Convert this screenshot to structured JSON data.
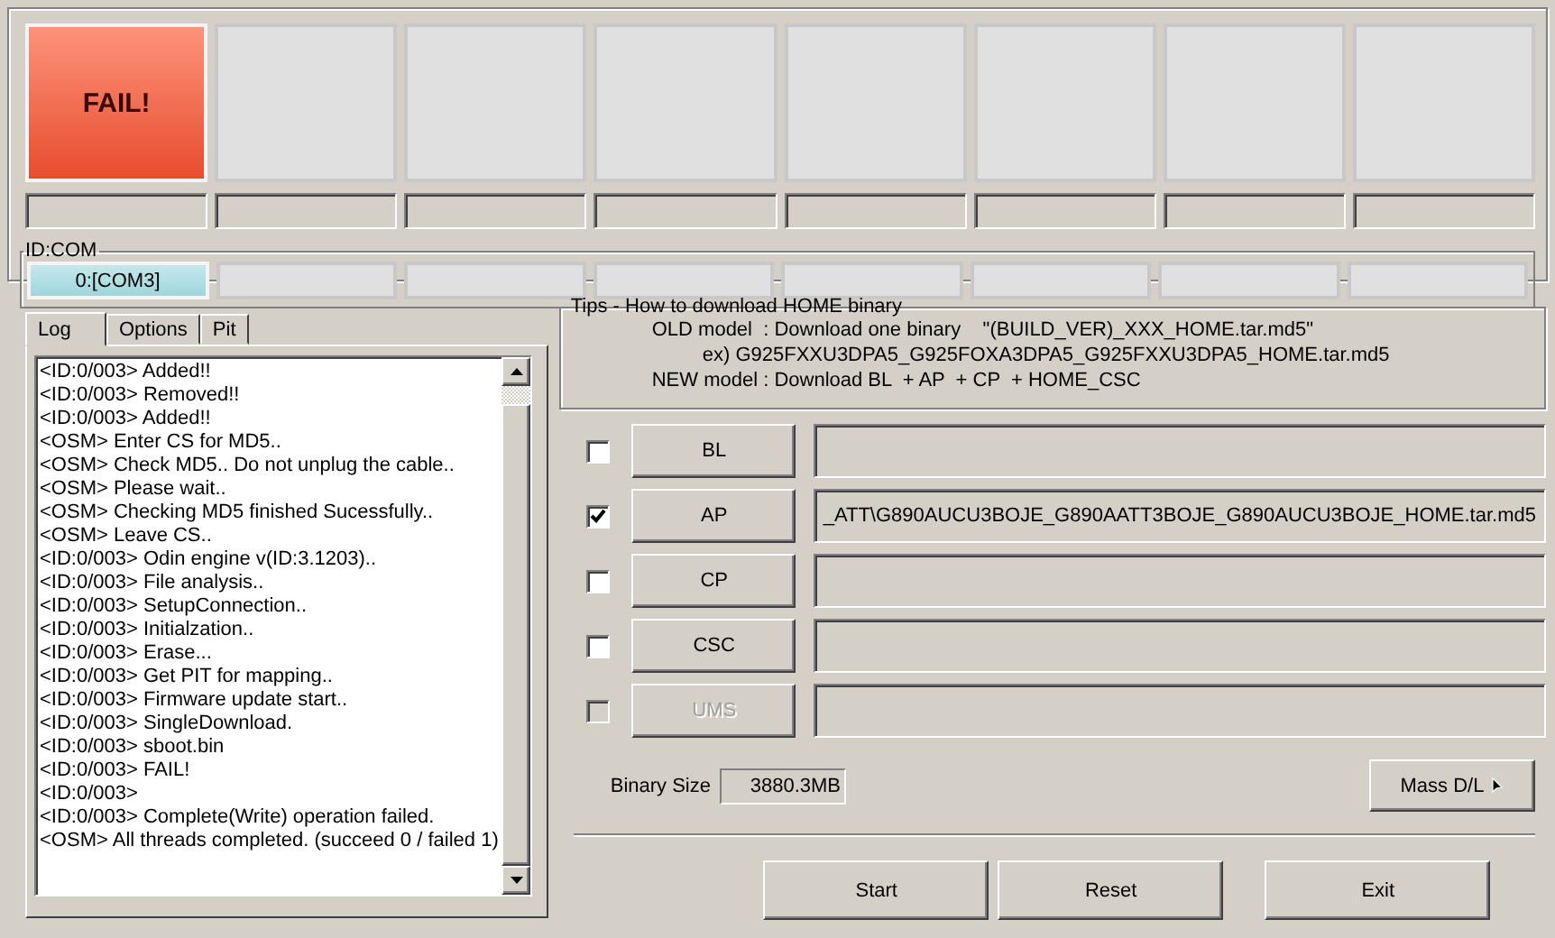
{
  "slots": [
    {
      "failed": true,
      "text": "FAIL!",
      "level": 0
    },
    {
      "failed": false,
      "level": 0
    },
    {
      "failed": false,
      "level": 0
    },
    {
      "failed": false,
      "level": 0
    },
    {
      "failed": false,
      "level": 0
    },
    {
      "failed": false,
      "level": 0
    },
    {
      "failed": false,
      "level": 0
    },
    {
      "failed": false,
      "level": 0
    }
  ],
  "id_com": {
    "label": "ID:COM",
    "ports": [
      {
        "connected": true,
        "text": "0:[COM3]"
      },
      {
        "connected": false
      },
      {
        "connected": false
      },
      {
        "connected": false
      },
      {
        "connected": false
      },
      {
        "connected": false
      },
      {
        "connected": false
      },
      {
        "connected": false
      }
    ]
  },
  "tabs": [
    {
      "label": "Log",
      "selected": true
    },
    {
      "label": "Options",
      "selected": false
    },
    {
      "label": "Pit",
      "selected": false
    }
  ],
  "log": [
    "<ID:0/003> Added!!",
    "<ID:0/003> Removed!!",
    "<ID:0/003> Added!!",
    "<OSM> Enter CS for MD5..",
    "<OSM> Check MD5.. Do not unplug the cable..",
    "<OSM> Please wait..",
    "<OSM> Checking MD5 finished Sucessfully..",
    "<OSM> Leave CS..",
    "<ID:0/003> Odin engine v(ID:3.1203)..",
    "<ID:0/003> File analysis..",
    "<ID:0/003> SetupConnection..",
    "<ID:0/003> Initialzation..",
    "<ID:0/003> Erase...",
    "<ID:0/003> Get PIT for mapping..",
    "<ID:0/003> Firmware update start..",
    "<ID:0/003> SingleDownload.",
    "<ID:0/003> sboot.bin",
    "<ID:0/003> FAIL!",
    "<ID:0/003>",
    "<ID:0/003> Complete(Write) operation failed.",
    "<OSM> All threads completed. (succeed 0 / failed 1)"
  ],
  "tips": {
    "title": "Tips - How to download HOME binary",
    "lines": [
      {
        "kind": "main",
        "text": "OLD model  : Download one binary    \"(BUILD_VER)_XXX_HOME.tar.md5\""
      },
      {
        "kind": "example",
        "text": "ex) G925FXXU3DPA5_G925FOXA3DPA5_G925FXXU3DPA5_HOME.tar.md5"
      },
      {
        "kind": "main",
        "text": "NEW model : Download BL  + AP  + CP  + HOME_CSC"
      }
    ]
  },
  "files": [
    {
      "label": "BL",
      "checked": false,
      "disabled": false
    },
    {
      "label": "AP",
      "checked": true,
      "disabled": false,
      "value": "_ATT\\G890AUCU3BOJE_G890AATT3BOJE_G890AUCU3BOJE_HOME.tar.md5"
    },
    {
      "label": "CP",
      "checked": false,
      "disabled": false
    },
    {
      "label": "CSC",
      "checked": false,
      "disabled": false
    },
    {
      "label": "UMS",
      "checked": false,
      "disabled": true
    }
  ],
  "binary_size": {
    "label": "Binary Size",
    "value": "3880.3MB"
  },
  "mass_dl": "Mass D/L",
  "buttons": [
    "Start",
    "Reset",
    "Exit"
  ]
}
